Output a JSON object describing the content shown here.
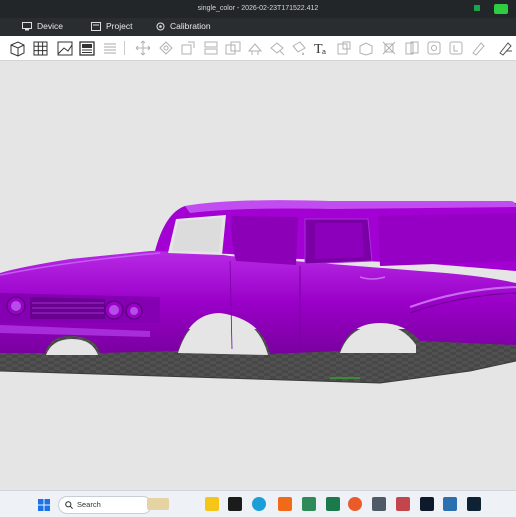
{
  "window": {
    "title": "single_color - 2026-02-23T171522.412"
  },
  "menu": {
    "items": [
      {
        "label": "Device",
        "icon": "monitor-icon"
      },
      {
        "label": "Project",
        "icon": "folder-icon"
      },
      {
        "label": "Calibration",
        "icon": "calibration-icon"
      }
    ]
  },
  "toolbar": {
    "icons": [
      "add-object-icon",
      "grid-plate-icon",
      "auto-arrange-icon",
      "plate-layout-icon",
      "list-icon",
      "move-icon",
      "rotate-icon",
      "scale-icon",
      "split-icon",
      "merge-icon",
      "support-paint-icon",
      "seam-paint-icon",
      "color-paint-icon",
      "text-icon",
      "boolean-icon",
      "cut-icon",
      "measure-icon",
      "assembly-icon",
      "view-cube-icon",
      "layer-icon",
      "edit-icon",
      "shortcut-icon"
    ]
  },
  "viewport": {
    "model_color": "#9c00c8",
    "plate_color": "#4f4f4f"
  },
  "taskbar": {
    "search_placeholder": "Search",
    "apps": [
      "start-icon",
      "search-icon",
      "widgets-icon",
      "file-explorer-icon",
      "media-icon",
      "edge-icon",
      "orca-icon",
      "store-icon",
      "firefox-icon",
      "calculator-icon",
      "slicer-icon",
      "terminal-icon",
      "photos-icon",
      "app-icon"
    ]
  }
}
